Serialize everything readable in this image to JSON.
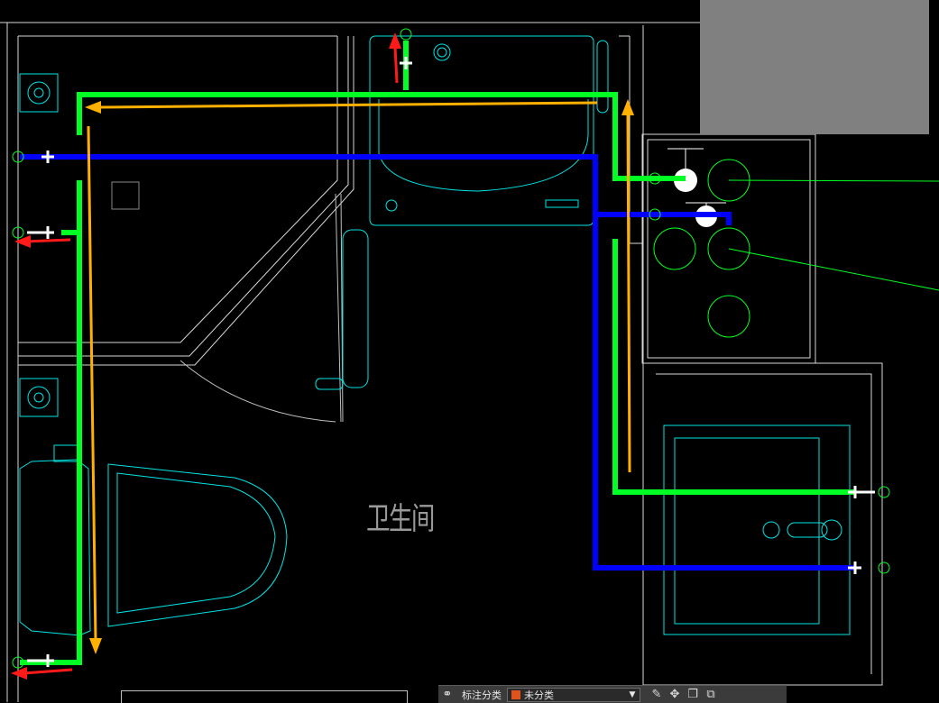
{
  "room_label": "卫生间",
  "toolbar": {
    "category_label": "标注分类",
    "category_value": "未分类",
    "category_color": "#e0531c",
    "icons": [
      "annotate-icon",
      "edit-icon",
      "move-icon",
      "copy-icon",
      "stack-icon"
    ]
  },
  "colors": {
    "hot_water": "#00ff22",
    "cold_water": "#0000ff",
    "flow_arrow": "#ffb000",
    "outlet_arrow": "#ff1a1a",
    "fixture_line": "#00ffff",
    "wall_line": "#d8d8d8",
    "marker": "#00ff22"
  }
}
